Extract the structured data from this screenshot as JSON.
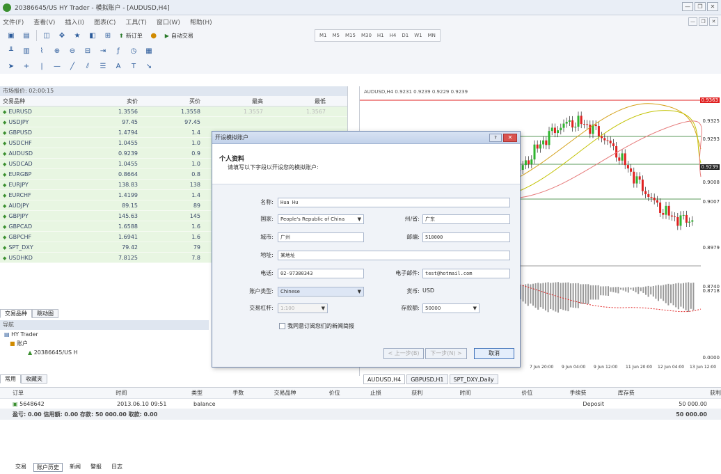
{
  "window": {
    "title": "20386645/US HY Trader - 模拟账户 - [AUDUSD,H4]",
    "controls": [
      "—",
      "❐",
      "✕"
    ],
    "inner_controls": [
      "—",
      "❐",
      "✕"
    ]
  },
  "menubar": [
    "文件(F)",
    "查看(V)",
    "插入(I)",
    "图表(C)",
    "工具(T)",
    "窗口(W)",
    "帮助(H)"
  ],
  "toolbar": {
    "new_order_label": "新订单",
    "autotrade_label": "自动交易",
    "timeframes": [
      "M1",
      "M5",
      "M15",
      "M30",
      "H1",
      "H4",
      "D1",
      "W1",
      "MN"
    ]
  },
  "market_watch": {
    "title": "市场报价: 02:00:15",
    "columns": [
      "交易品种",
      "卖价",
      "买价",
      "最高",
      "最低"
    ],
    "rows": [
      {
        "symbol": "EURUSD",
        "bid": "1.3556",
        "ask": "1.3558",
        "high": "1.3557",
        "low": "1.3567"
      },
      {
        "symbol": "USDJPY",
        "bid": "97.45",
        "ask": "97.45",
        "high": "",
        "low": ""
      },
      {
        "symbol": "GBPUSD",
        "bid": "1.4794",
        "ask": "1.4",
        "high": "",
        "low": ""
      },
      {
        "symbol": "USDCHF",
        "bid": "1.0455",
        "ask": "1.0",
        "high": "",
        "low": ""
      },
      {
        "symbol": "AUDUSD",
        "bid": "0.9239",
        "ask": "0.9",
        "high": "",
        "low": ""
      },
      {
        "symbol": "USDCAD",
        "bid": "1.0455",
        "ask": "1.0",
        "high": "",
        "low": ""
      },
      {
        "symbol": "EURGBP",
        "bid": "0.8664",
        "ask": "0.8",
        "high": "",
        "low": ""
      },
      {
        "symbol": "EURJPY",
        "bid": "138.83",
        "ask": "138",
        "high": "",
        "low": ""
      },
      {
        "symbol": "EURCHF",
        "bid": "1.4199",
        "ask": "1.4",
        "high": "",
        "low": ""
      },
      {
        "symbol": "AUDJPY",
        "bid": "89.15",
        "ask": "89",
        "high": "",
        "low": ""
      },
      {
        "symbol": "GBPJPY",
        "bid": "145.63",
        "ask": "145",
        "high": "",
        "low": ""
      },
      {
        "symbol": "GBPCAD",
        "bid": "1.6588",
        "ask": "1.6",
        "high": "",
        "low": ""
      },
      {
        "symbol": "GBPCHF",
        "bid": "1.6941",
        "ask": "1.6",
        "high": "",
        "low": ""
      },
      {
        "symbol": "SPT_DXY",
        "bid": "79.42",
        "ask": "79",
        "high": "",
        "low": ""
      },
      {
        "symbol": "USDHKD",
        "bid": "7.8125",
        "ask": "7.8",
        "high": "",
        "low": ""
      }
    ],
    "tabs": [
      "交易品种",
      "跳动图"
    ]
  },
  "navigator": {
    "title": "导航",
    "tree": [
      "HY Trader",
      "账户",
      "20386645/US H"
    ],
    "tabs": [
      "常用",
      "收藏夹"
    ]
  },
  "chart": {
    "title": "AUDUSD,H4  0.9231 0.9239 0.9229 0.9239",
    "price_labels": [
      "0.9363",
      "0.9325",
      "0.9293",
      "0.9239",
      "0.9008",
      "0.9007",
      "0.8979",
      "0.8740",
      "0.8718",
      "0.0000"
    ],
    "time_labels": [
      "7 Jun 20:00",
      "9 Jun 04:00",
      "9 Jun 12:00",
      "11 Jun 20:00",
      "12 Jun 04:00",
      "13 Jun 12:00"
    ],
    "tabs": [
      "AUDUSD,H4",
      "GBPUSD,H1",
      "SPT_DXY,Daily"
    ]
  },
  "terminal": {
    "columns": [
      "订单",
      "时间",
      "类型",
      "手数",
      "交易品种",
      "价位",
      "止损",
      "获利",
      "时间",
      "价位",
      "手续费",
      "库存费",
      "获利"
    ],
    "rows": [
      {
        "order": "5648642",
        "time": "2013.06.10 09:51",
        "type": "balance",
        "comment": "Deposit",
        "profit": "50 000.00"
      }
    ],
    "summary": "盈亏: 0.00  信用额: 0.00  存款: 50 000.00  取款: 0.00",
    "summary_total": "50 000.00",
    "tabs": [
      "交易",
      "账户历史",
      "新闻",
      "警报",
      "日志"
    ]
  },
  "dialog": {
    "title": "开设模拟账户",
    "header_title": "个人资料",
    "header_subtitle": "请填写以下字段以开设您的模拟账户:",
    "fields": {
      "name_label": "名称:",
      "name_value": "Hua Hu",
      "country_label": "国家:",
      "country_value": "People's Republic of China",
      "state_label": "州/省:",
      "state_value": "广东",
      "city_label": "城市:",
      "city_value": "广州",
      "zip_label": "邮编:",
      "zip_value": "510000",
      "address_label": "地址:",
      "address_value": "某地址",
      "phone_label": "电话:",
      "phone_value": "02-97380343",
      "email_label": "电子邮件:",
      "email_value": "test@hotmail.com",
      "account_type_label": "账户类型:",
      "account_type_value": "Chinese",
      "currency_label": "货币:",
      "currency_value": "USD",
      "leverage_label": "交易杠杆:",
      "leverage_value": "1:100",
      "deposit_label": "存款额:",
      "deposit_value": "50000"
    },
    "checkbox_label": "我同意订阅您们的新闻简报",
    "buttons": {
      "back": "< 上一步(B)",
      "next": "下一步(N) >",
      "cancel": "取消"
    }
  }
}
